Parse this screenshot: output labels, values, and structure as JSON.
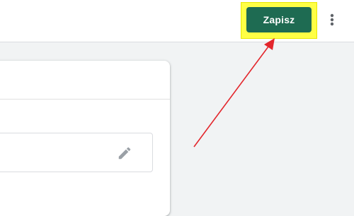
{
  "toolbar": {
    "save_label": "Zapisz",
    "more_icon": "more-vert-icon"
  },
  "card": {
    "field": {
      "edit_icon": "pencil-icon"
    }
  },
  "colors": {
    "save_button": "#1e6b52",
    "highlight": "#ffff45",
    "annotation_arrow": "#e3262c",
    "background": "#f1f3f4"
  }
}
